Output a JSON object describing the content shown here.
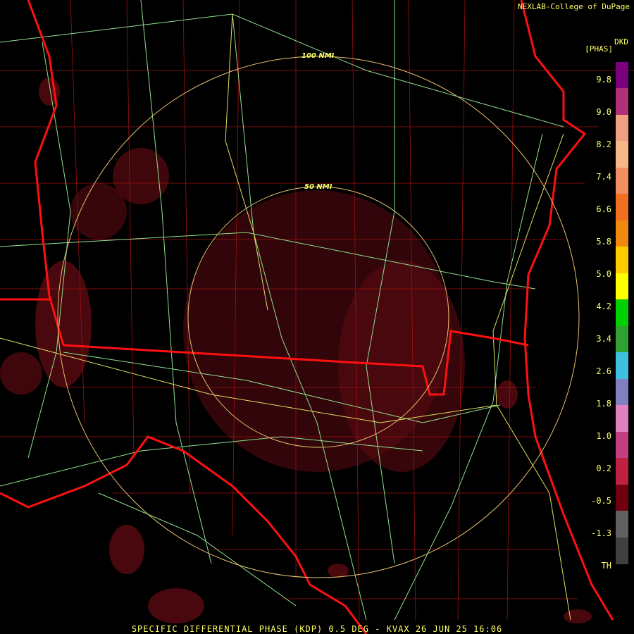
{
  "credit": "NEXLAB-College of DuPage",
  "product": {
    "abbr": "DKD",
    "unit": "[PHAS]"
  },
  "legend": {
    "labels": [
      "9.8",
      "9.0",
      "8.2",
      "7.4",
      "6.6",
      "5.8",
      "5.0",
      "4.2",
      "3.4",
      "2.6",
      "1.8",
      "1.0",
      "0.2",
      "-0.5",
      "-1.3",
      "TH"
    ],
    "colors": [
      "#7a0080",
      "#b0307a",
      "#f0a080",
      "#f6b888",
      "#f09060",
      "#f07020",
      "#f08a10",
      "#ffcc00",
      "#ffff00",
      "#00d000",
      "#30a030",
      "#40c0e0",
      "#8080c0",
      "#e080c0",
      "#c04080",
      "#c02040",
      "#700010",
      "#606060",
      "#404040"
    ]
  },
  "range_rings": [
    {
      "label": "100 NMI"
    },
    {
      "label": "50 NMI"
    }
  ],
  "footer": "SPECIFIC DIFFERENTIAL PHASE (KDP) 0.5 DEG - KVAX 26 JUN 25 16:06"
}
